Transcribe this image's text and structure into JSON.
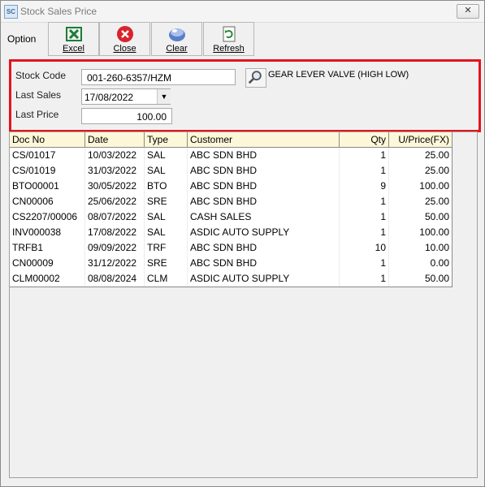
{
  "window": {
    "title": "Stock Sales Price",
    "icon_text": "SC",
    "close_glyph": "✕"
  },
  "toolbar": {
    "option_label": "Option",
    "buttons": [
      {
        "label": "Excel",
        "icon": "excel-icon"
      },
      {
        "label": "Close",
        "icon": "close-red-icon"
      },
      {
        "label": "Clear",
        "icon": "clear-icon"
      },
      {
        "label": "Refresh",
        "icon": "refresh-icon"
      }
    ]
  },
  "header": {
    "stock_code_label": "Stock Code",
    "stock_code_value": "001-260-6357/HZM",
    "description": "GEAR LEVER VALVE (HIGH LOW)",
    "last_sales_label": "Last Sales",
    "last_sales_value": "17/08/2022",
    "last_price_label": "Last Price",
    "last_price_value": "100.00",
    "highlight_color": "#e3141e"
  },
  "grid": {
    "columns": [
      "Doc No",
      "Date",
      "Type",
      "Customer",
      "Qty",
      "U/Price(FX)"
    ],
    "header_bg": "#fcf7d8",
    "rows": [
      [
        "CS/01017",
        "10/03/2022",
        "SAL",
        "ABC SDN BHD",
        "1",
        "25.00"
      ],
      [
        "CS/01019",
        "31/03/2022",
        "SAL",
        "ABC SDN BHD",
        "1",
        "25.00"
      ],
      [
        "BTO00001",
        "30/05/2022",
        "BTO",
        "ABC SDN BHD",
        "9",
        "100.00"
      ],
      [
        "CN00006",
        "25/06/2022",
        "SRE",
        "ABC SDN BHD",
        "1",
        "25.00"
      ],
      [
        "CS2207/00006",
        "08/07/2022",
        "SAL",
        "CASH SALES",
        "1",
        "50.00"
      ],
      [
        "INV000038",
        "17/08/2022",
        "SAL",
        "ASDIC AUTO SUPPLY",
        "1",
        "100.00"
      ],
      [
        "TRFB1",
        "09/09/2022",
        "TRF",
        "ABC SDN BHD",
        "10",
        "10.00"
      ],
      [
        "CN00009",
        "31/12/2022",
        "SRE",
        "ABC SDN BHD",
        "1",
        "0.00"
      ],
      [
        "CLM00002",
        "08/08/2024",
        "CLM",
        "ASDIC AUTO SUPPLY",
        "1",
        "50.00"
      ]
    ]
  }
}
